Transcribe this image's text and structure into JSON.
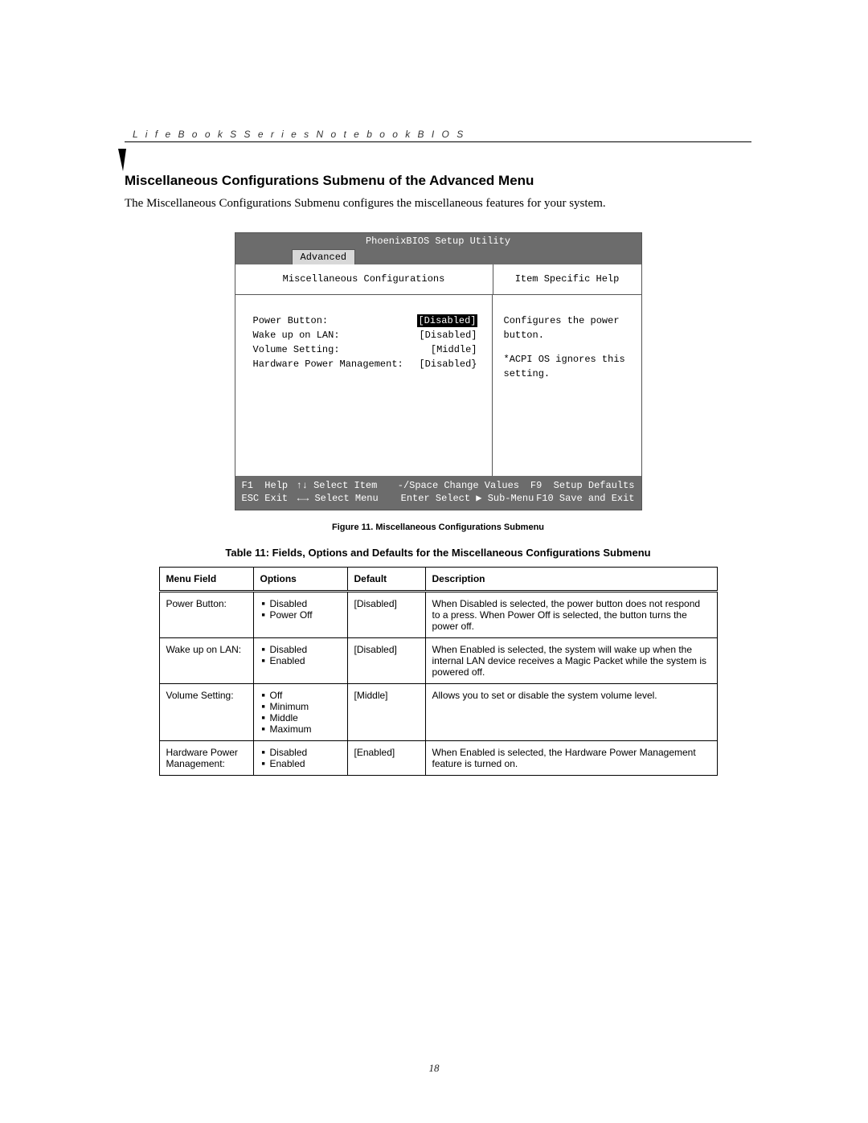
{
  "header": {
    "running": "L i f e B o o k   S   S e r i e s   N o t e b o o k   B I O S"
  },
  "section": {
    "title": "Miscellaneous Configurations Submenu of the Advanced Menu",
    "intro": "The Miscellaneous Configurations Submenu configures the miscellaneous features for your system."
  },
  "bios": {
    "title": "PhoenixBIOS Setup Utility",
    "tab": "Advanced",
    "left_header": "Miscellaneous Configurations",
    "right_header": "Item Specific Help",
    "options": [
      {
        "label": "Power Button:",
        "value": "[Disabled]",
        "selected": true
      },
      {
        "label": "Wake up on LAN:",
        "value": "[Disabled]",
        "selected": false
      },
      {
        "label": "Volume Setting:",
        "value": "[Middle]",
        "selected": false
      },
      {
        "label": "Hardware Power Management:",
        "value": "[Disabled}",
        "selected": false
      }
    ],
    "help": {
      "line1": "Configures the power",
      "line2": "button.",
      "line3": "*ACPI OS ignores this",
      "line4": "setting."
    },
    "footer": {
      "r1c1": "F1  Help",
      "r1c2": "↑↓ Select Item",
      "r1c3": "-/Space Change Values",
      "r1c4": "F9  Setup Defaults",
      "r2c1": "ESC Exit",
      "r2c2": "←→ Select Menu",
      "r2c3": "Enter Select ▶ Sub-Menu",
      "r2c4": "F10 Save and Exit"
    }
  },
  "figure_caption": "Figure 11.  Miscellaneous Configurations Submenu",
  "table": {
    "caption": "Table 11: Fields, Options and Defaults for the Miscellaneous Configurations Submenu",
    "headers": {
      "c1": "Menu Field",
      "c2": "Options",
      "c3": "Default",
      "c4": "Description"
    },
    "rows": [
      {
        "field": "Power Button:",
        "options": [
          "Disabled",
          "Power Off"
        ],
        "def": "[Disabled]",
        "desc": "When Disabled is selected, the power button does not respond to a press. When Power Off is selected, the button turns the power off."
      },
      {
        "field": "Wake up on LAN:",
        "options": [
          "Disabled",
          "Enabled"
        ],
        "def": "[Disabled]",
        "desc": "When Enabled is selected, the system will wake up when the internal LAN device receives a Magic Packet while the system is powered off."
      },
      {
        "field": "Volume Setting:",
        "options": [
          "Off",
          "Minimum",
          "Middle",
          "Maximum"
        ],
        "def": "[Middle]",
        "desc": "Allows you to set or disable the system volume level."
      },
      {
        "field": "Hardware Power Management:",
        "options": [
          "Disabled",
          "Enabled"
        ],
        "def": "[Enabled]",
        "desc": "When Enabled is selected, the Hardware Power Management feature is turned on."
      }
    ]
  },
  "page_number": "18"
}
